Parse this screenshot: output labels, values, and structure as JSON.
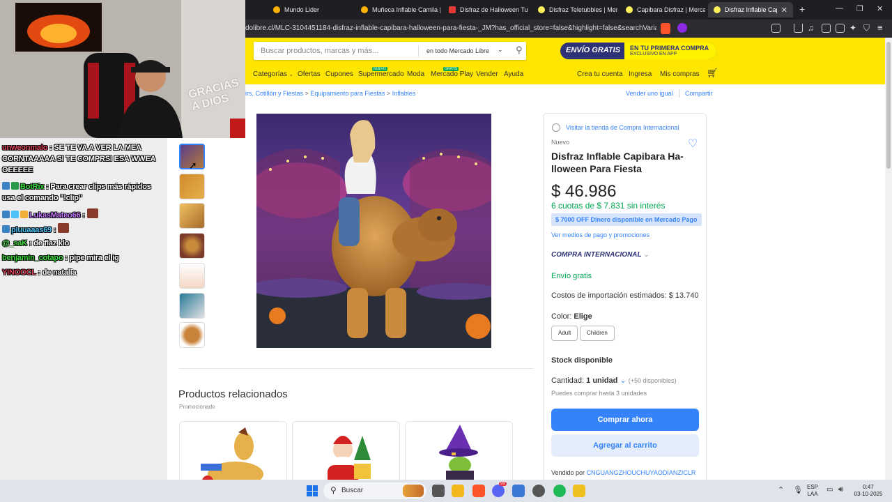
{
  "browser": {
    "tabs": [
      {
        "label": "Mundo Lider",
        "color": "#ffb300"
      },
      {
        "label": "Muñeca Inflable Camila | L",
        "color": "#ffb300"
      },
      {
        "label": "Disfraz de Halloween Tung",
        "color": "#e53935"
      },
      {
        "label": "Disfraz Teletubbies | Merc",
        "color": "#fff159"
      },
      {
        "label": "Capibara Disfraz | Mercad",
        "color": "#fff159"
      },
      {
        "label": "Disfraz Inflable Capiba",
        "color": "#fff159"
      }
    ],
    "new_tab": "+",
    "url": "dolibre.cl/MLC-3104451184-disfraz-inflable-capibara-halloween-para-fiesta-_JM?has_official_store=false&highlight=false&searchVariation..."
  },
  "header": {
    "search_placeholder": "Buscar productos, marcas y más...",
    "search_scope": "en todo Mercado Libre",
    "promo_main": "ENVÍO GRATIS",
    "promo_line1": "EN TU PRIMERA COMPRA",
    "promo_line2": "EXCLUSIVO EN APP",
    "nav": {
      "categorias": "Categorías",
      "ofertas": "Ofertas",
      "cupones": "Cupones",
      "supermercado": "Supermercado",
      "supermercado_badge": "NUEVO",
      "moda": "Moda",
      "mercado_play": "Mercado Play",
      "mercado_play_badge": "GRATIS",
      "vender": "Vender",
      "ayuda": "Ayuda",
      "crea_cuenta": "Crea tu cuenta",
      "ingresa": "Ingresa",
      "mis_compras": "Mis compras"
    }
  },
  "breadcrumb": {
    "items": [
      "irs, Cotillón y Fiestas",
      "Equipamiento para Fiestas",
      "Inflables"
    ],
    "sep": ">",
    "vender_igual": "Vender uno igual",
    "compartir": "Compartir"
  },
  "product": {
    "store_link": "Visitar la tienda de Compra Internacional",
    "condition": "Nuevo",
    "title_line1": "Disfraz Inflable Capibara Ha-",
    "title_line2": "lloween Para Fiesta",
    "price": "$ 46.986",
    "installments": "6 cuotas de $ 7.831 sin interés",
    "discount_tag": "$ 7000 OFF Dinero disponible en Mercado Pago",
    "payment_link": "Ver medios de pago y promociones",
    "international": "COMPRA INTERNACIONAL",
    "shipping": "Envío gratis",
    "import_costs": "Costos de importación estimados: $ 13.740",
    "color_label": "Color:",
    "color_value": "Elige",
    "options": [
      "Adult",
      "Children"
    ],
    "stock": "Stock disponible",
    "quantity_label": "Cantidad:",
    "quantity_value": "1 unidad",
    "available": "(+50 disponibles)",
    "limit": "Puedes comprar hasta 3 unidades",
    "buy_now": "Comprar ahora",
    "add_cart": "Agregar al carrito",
    "seller_label": "Vendido por",
    "seller": "CNGUANGZHOUCHUYAODIANZICLR"
  },
  "related": {
    "title": "Productos relacionados",
    "subtitle": "Promocionado"
  },
  "chat": [
    {
      "user": "unweonmalo",
      "color": "#e0435a",
      "msg": ": SE TE VA A VER LA MEA CORNTAAAAA SI TE COMPRSI ESA WWEA OEEEEE"
    },
    {
      "user": "BotRix",
      "color": "#3ddc3d",
      "msg": ": Para crear clips más rápidos usa el comando \"!clip\""
    },
    {
      "user": "LukasMateo66",
      "color": "#c77dff",
      "msg": ":"
    },
    {
      "user": "pluuaaas69",
      "color": "#4fc3f7",
      "msg": ":"
    },
    {
      "user": "@_saK",
      "color": "#3ddc3d",
      "msg": ": de flaz klo"
    },
    {
      "user": "benjamin_cotapo",
      "color": "#3ddc3d",
      "msg": ": pipe mira el ig"
    },
    {
      "user": "YINOOCL",
      "color": "#e0435a",
      "msg": ": de natalia"
    }
  ],
  "cam": {
    "overlay_text": "GRACIAS A DIOS"
  },
  "taskbar": {
    "search": "Buscar",
    "lang1": "ESP",
    "lang2": "LAA",
    "time": "0:47",
    "date": "03-10-2025",
    "discord_badge": "99"
  }
}
